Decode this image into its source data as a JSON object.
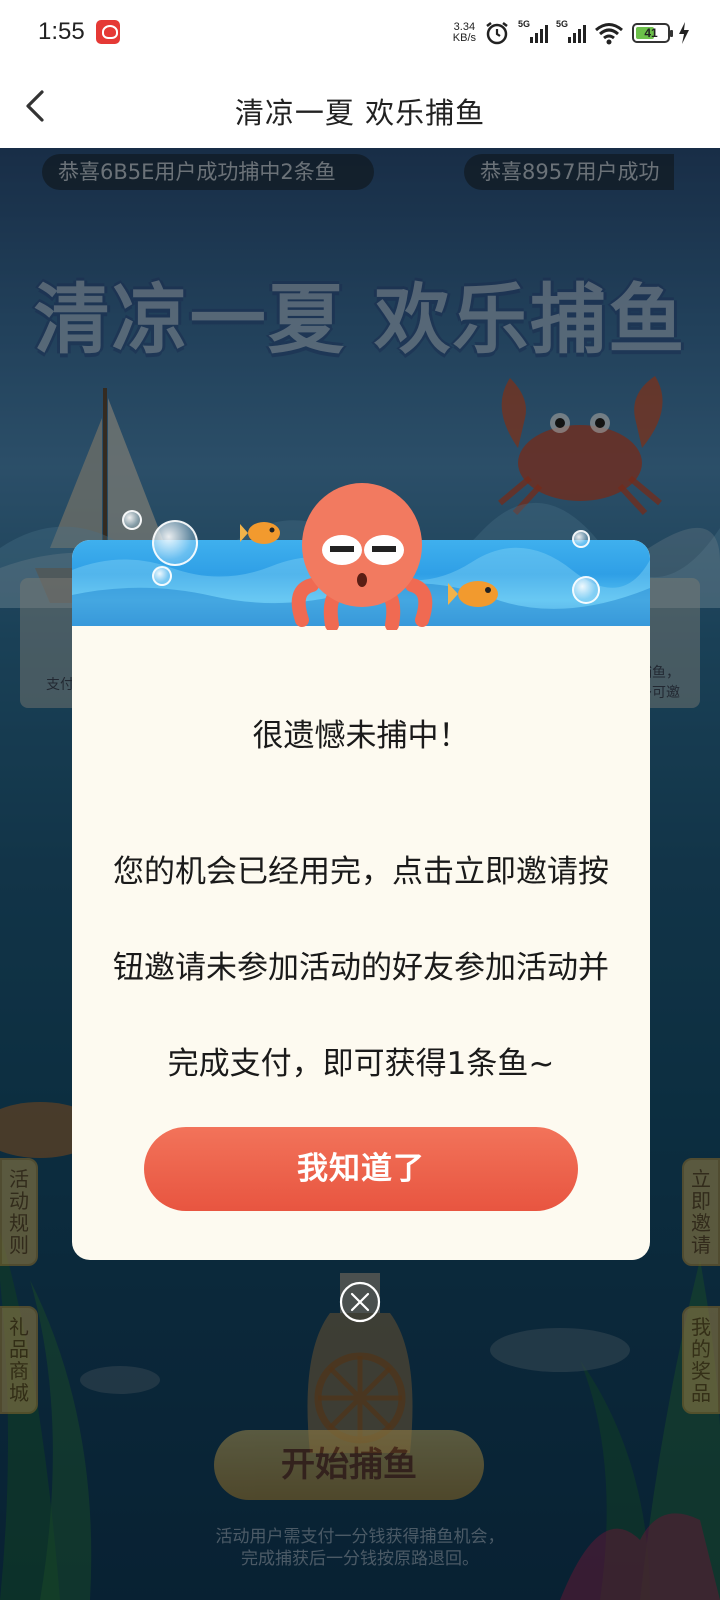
{
  "status_bar": {
    "time": "1:55",
    "net_speed_value": "3.34",
    "net_speed_unit": "KB/s",
    "sim1_label": "5G",
    "sim2_label": "5G",
    "battery_level": "41"
  },
  "nav": {
    "title": "清凉一夏 欢乐捕鱼"
  },
  "game": {
    "ticker_1": "恭喜6B5E用户成功捕中2条鱼",
    "ticker_2": "恭喜8957用户成功",
    "hero_title": "清凉一夏 欢乐捕鱼",
    "side_card_left_text": "支付",
    "side_card_right_text_1": "捕鱼，",
    "side_card_right_text_2": "多可邀",
    "tab_rules": "活动规则",
    "tab_mall": "礼品商城",
    "tab_invite": "立即邀请",
    "tab_prizes": "我的奖品",
    "start_button": "开始捕鱼",
    "footer_note_1": "活动用户需支付一分钱获得捕鱼机会，",
    "footer_note_2": "完成捕获后一分钱按原路退回。"
  },
  "dialog": {
    "title": "很遗憾未捕中！",
    "message": "您的机会已经用完，点击立即邀请按钮邀请未参加活动的好友参加活动并完成支付，即可获得1条鱼~",
    "confirm_button": "我知道了"
  },
  "colors": {
    "dialog_bg": "#fdfaf0",
    "button_accent": "#ea5c45",
    "tab_gold": "#e3c46f"
  }
}
